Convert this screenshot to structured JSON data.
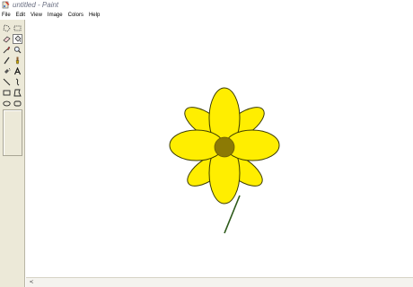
{
  "window": {
    "title": "untitled - Paint",
    "app_icon": "paint-app-icon"
  },
  "menu": [
    {
      "label": "File"
    },
    {
      "label": "Edit"
    },
    {
      "label": "View"
    },
    {
      "label": "Image"
    },
    {
      "label": "Colors"
    },
    {
      "label": "Help"
    }
  ],
  "toolbox": {
    "tools": [
      {
        "name": "free-form-select-icon"
      },
      {
        "name": "select-icon"
      },
      {
        "name": "eraser-icon"
      },
      {
        "name": "fill-with-color-icon",
        "selected": true
      },
      {
        "name": "pick-color-icon"
      },
      {
        "name": "magnifier-icon"
      },
      {
        "name": "pencil-icon"
      },
      {
        "name": "brush-icon"
      },
      {
        "name": "airbrush-icon"
      },
      {
        "name": "text-icon"
      },
      {
        "name": "line-icon"
      },
      {
        "name": "curve-icon"
      },
      {
        "name": "rectangle-icon"
      },
      {
        "name": "polygon-icon"
      },
      {
        "name": "ellipse-icon"
      },
      {
        "name": "rounded-rectangle-icon"
      }
    ]
  },
  "canvas": {
    "drawing": "flower",
    "colors": {
      "petal_fill": "#ffee00",
      "petal_outline": "#3a3a00",
      "center_fill": "#8c7a05",
      "stem": "#2d5a1a"
    }
  },
  "colors": {
    "toolbox_bg": "#ece9d8",
    "title_text": "#6a6f82"
  }
}
